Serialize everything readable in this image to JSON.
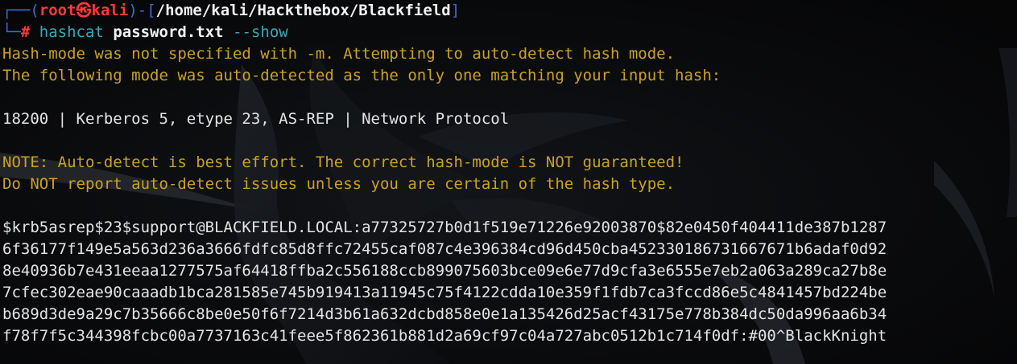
{
  "prompt": {
    "frame_top_left": "┌──(",
    "user": "root",
    "skull": "㉿",
    "host": "kali",
    "frame_mid": ")-[",
    "cwd": "/home/kali/Hackthebox/Blackfield",
    "frame_close": "]",
    "frame_bottom_left": "└─",
    "symbol": "#",
    "command": "hashcat",
    "argument": "password.txt",
    "flag": "--show"
  },
  "output": {
    "warn_line_1": "Hash-mode was not specified with -m. Attempting to auto-detect hash mode.",
    "warn_line_2": "The following mode was auto-detected as the only one matching your input hash:",
    "mode_line": "18200 | Kerberos 5, etype 23, AS-REP | Network Protocol",
    "note_line_1": "NOTE: Auto-detect is best effort. The correct hash-mode is NOT guaranteed!",
    "note_line_2": "Do NOT report auto-detect issues unless you are certain of the hash type.",
    "hash_lines": [
      "$krb5asrep$23$support@BLACKFIELD.LOCAL:a77325727b0d1f519e71226e92003870$82e0450f404411de387b1287",
      "6f36177f149e5a563d236a3666fdfc85d8ffc72455caf087c4e396384cd96d450cba452330186731667671b6adaf0d92",
      "8e40936b7e431eeaa1277575af64418ffba2c556188ccb899075603bce09e6e77d9cfa3e6555e7eb2a063a289ca27b8e",
      "7cfec302eae90caaadb1bca281585e745b919413a11945c75f4122cdda10e359f1fdb7ca3fccd86e5c4841457bd224be",
      "b689d3de9a29c7b35666c8be0e50f6f7214d3b61a632dcbd858e0e1a135426d25acf43175e778b384dc50da996aa6b34",
      "f78f7f5c344398fcbc00a7737163c41feee5f862361b881d2a69cf97c04a727abc0512b1c714f0df:#00^BlackKnight"
    ]
  },
  "colors": {
    "background": "#070709",
    "prompt_frame": "#3b6ed6",
    "prompt_user": "#ff3a3a",
    "command": "#3aa8b8",
    "warning_text": "#c9a227",
    "plain_text": "#e4e4e4"
  }
}
